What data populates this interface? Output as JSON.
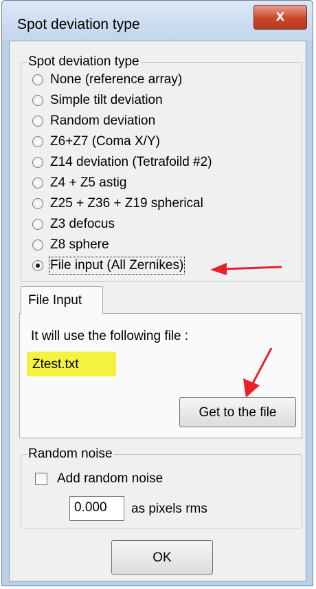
{
  "window": {
    "title": "Spot deviation type",
    "close_glyph": "x"
  },
  "deviation_group": {
    "legend": "Spot deviation type",
    "options": [
      {
        "label": "None (reference array)",
        "selected": false
      },
      {
        "label": "Simple tilt deviation",
        "selected": false
      },
      {
        "label": "Random deviation",
        "selected": false
      },
      {
        "label": "Z6+Z7 (Coma X/Y)",
        "selected": false
      },
      {
        "label": "Z14 deviation (Tetrafoild #2)",
        "selected": false
      },
      {
        "label": "Z4 + Z5 astig",
        "selected": false
      },
      {
        "label": "Z25 + Z36 + Z19 spherical",
        "selected": false
      },
      {
        "label": "Z3 defocus",
        "selected": false
      },
      {
        "label": "Z8 sphere",
        "selected": false
      },
      {
        "label": "File input (All Zernikes)",
        "selected": true
      }
    ]
  },
  "file_tab": {
    "tab_label": "File Input",
    "description": "It will use the following file :",
    "filename": "Ztest.txt",
    "button_label": "Get to the file",
    "highlight_color": "#f4f240"
  },
  "noise_group": {
    "legend": "Random noise",
    "checkbox_label": "Add random noise",
    "checked": false,
    "value": "0.000",
    "unit_label": "as pixels rms"
  },
  "ok_button": {
    "label": "OK"
  },
  "annotations": {
    "arrow_color": "#e8202a",
    "arrow_count": 2
  }
}
